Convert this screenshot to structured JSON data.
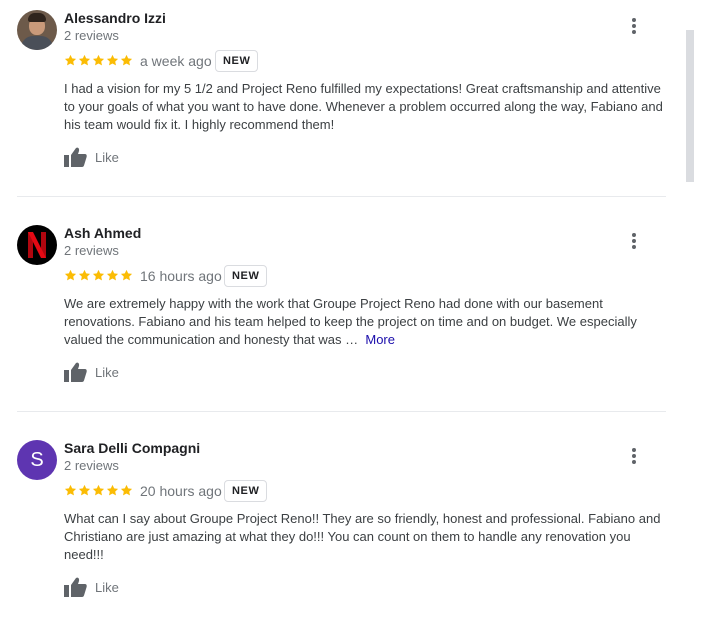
{
  "reviews": [
    {
      "name": "Alessandro Izzi",
      "count": "2 reviews",
      "avatar": "profile-photo",
      "rating": 5,
      "when": "a week ago",
      "badge": "NEW",
      "text": "I had a vision for my 5 1/2 and Project Reno fulfilled my expectations! Great craftsmanship and attentive to your goals of what you want to have done. Whenever a problem occurred along the way, Fabiano and his team would fix it. I highly recommend them!",
      "more": "",
      "like": "Like"
    },
    {
      "name": "Ash Ahmed",
      "count": "2 reviews",
      "avatar": "netflix-logo",
      "rating": 5,
      "when": "16 hours ago",
      "badge": "NEW",
      "text": "We are extremely happy with the work that Groupe Project Reno had done with our basement renovations. Fabiano and his team helped to keep the project on time and on budget. We especially valued the communication and honesty that was …",
      "more": "More",
      "like": "Like"
    },
    {
      "name": "Sara Delli Compagni",
      "count": "2 reviews",
      "avatar_letter": "S",
      "rating": 5,
      "when": "20 hours ago",
      "badge": "NEW",
      "text": "What can I say about Groupe Project Reno!! They are so friendly, honest and professional. Fabiano and Christiano are just amazing at what they do!!! You can count on them to handle  any renovation you need!!!",
      "more": "",
      "like": "Like"
    }
  ],
  "colors": {
    "star": "#fbbc04",
    "avatar_letter_bg": "#5e35b1",
    "link": "#1a0dab",
    "muted": "#70757a"
  },
  "icons": [
    "star-icon",
    "thumbs-up-icon",
    "more-vert-icon",
    "netflix-logo"
  ]
}
